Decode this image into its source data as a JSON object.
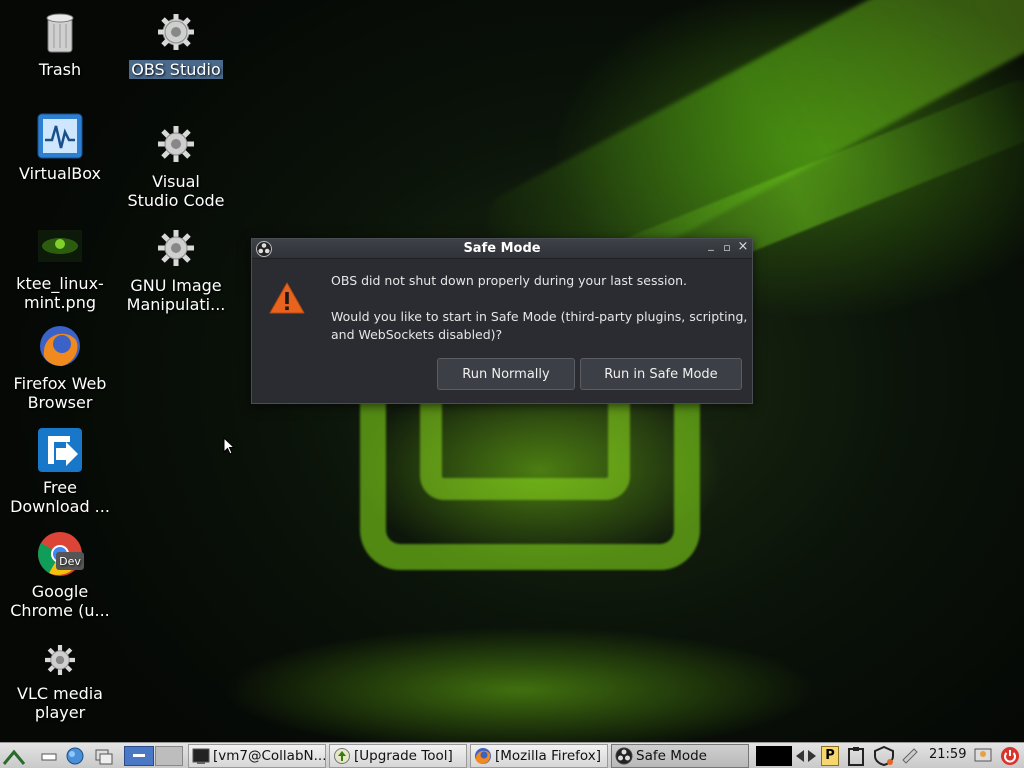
{
  "desktop": {
    "icons": [
      {
        "label": "Trash",
        "icon": "trash-icon"
      },
      {
        "label": "OBS Studio",
        "icon": "gear-icon"
      },
      {
        "label": "VirtualBox",
        "icon": "virtualbox-icon"
      },
      {
        "label": "Visual Studio Code",
        "icon": "gear-icon"
      },
      {
        "label": "ktee_linux-mint.png",
        "icon": "image-icon"
      },
      {
        "label": "GNU Image Manipulati...",
        "icon": "gear-icon"
      },
      {
        "label": "Firefox Web Browser",
        "icon": "firefox-icon"
      },
      {
        "label": "Free Download ...",
        "icon": "download-icon"
      },
      {
        "label": "Google Chrome (u...",
        "icon": "chrome-dev-icon"
      },
      {
        "label": "VLC media player",
        "icon": "gear-icon"
      }
    ],
    "chrome_badge": "Dev"
  },
  "dialog": {
    "title": "Safe Mode",
    "line1": "OBS did not shut down properly during your last session.",
    "line2": "Would you like to start in Safe Mode (third-party plugins, scripting,",
    "line3": "and WebSockets disabled)?",
    "btn_normal": "Run Normally",
    "btn_safe": "Run in Safe Mode",
    "ctrl_min": "_",
    "ctrl_max": "▫",
    "ctrl_close": "×"
  },
  "taskbar": {
    "tasks": [
      {
        "label": "[vm7@CollabN...",
        "icon": "terminal-icon"
      },
      {
        "label": "[Upgrade Tool]",
        "icon": "upgrade-tool-icon"
      },
      {
        "label": "[Mozilla Firefox]",
        "icon": "firefox-icon"
      },
      {
        "label": "Safe Mode",
        "icon": "obs-icon"
      }
    ],
    "clock": "21:59",
    "tray_p": "P"
  },
  "colors": {
    "dialog_bg": "#2a2c31",
    "warning": "#e8641e",
    "selection": "#4a6a8c"
  }
}
